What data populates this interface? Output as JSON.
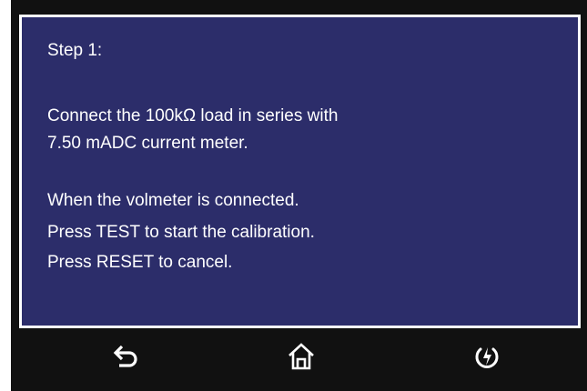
{
  "dialog": {
    "step_title": "Step 1:",
    "paragraph1": {
      "line1": "Connect the 100kΩ load in series with",
      "line2": "7.50 mADC current meter."
    },
    "paragraph2": {
      "line1": "When the volmeter is connected.",
      "line2": "Press TEST to start the calibration.",
      "line3": "Press RESET to cancel."
    }
  },
  "toolbar": {
    "icons": [
      "back-icon",
      "home-icon",
      "power-icon"
    ]
  },
  "colors": {
    "panel_background": "#2c2d6a",
    "panel_border": "#ffffff",
    "bar_background": "#111111",
    "text": "#ffffff"
  }
}
